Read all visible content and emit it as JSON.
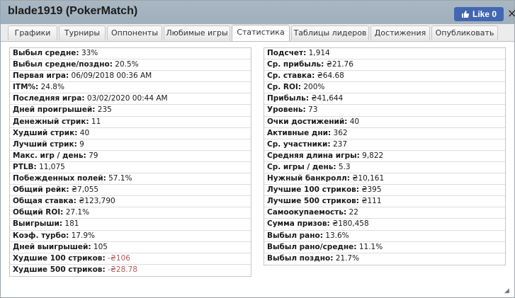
{
  "title": "blade1919 (PokerMatch)",
  "like_label": "Like 0",
  "tabs": [
    "Графики",
    "Турниры",
    "Оппоненты",
    "Любимые игры",
    "Статистика",
    "Таблицы лидеров",
    "Достижения",
    "Опубликовать"
  ],
  "active_tab": "Статистика",
  "left_stats": [
    {
      "label": "Выбыл средне:",
      "value": "33%"
    },
    {
      "label": "Выбыл средне/поздно:",
      "value": "20.5%"
    },
    {
      "label": "Первая игра:",
      "value": "06/09/2018 00:36 AM"
    },
    {
      "label": "ITM%:",
      "value": "24.8%"
    },
    {
      "label": "Последняя игра:",
      "value": "03/02/2020 00:44 AM"
    },
    {
      "label": "Дней проигрышей:",
      "value": "235"
    },
    {
      "label": "Денежный стрик:",
      "value": "11"
    },
    {
      "label": "Худший стрик:",
      "value": "40"
    },
    {
      "label": "Лучший стрик:",
      "value": "9"
    },
    {
      "label": "Макс. игр / день:",
      "value": "79"
    },
    {
      "label": "PTLB:",
      "value": "11,075"
    },
    {
      "label": "Побежденных полей:",
      "value": "57.1%"
    },
    {
      "label": "Общий рейк:",
      "value": "₴7,055"
    },
    {
      "label": "Общая ставка:",
      "value": "₴123,790"
    },
    {
      "label": "Общий ROI:",
      "value": "27.1%"
    },
    {
      "label": "Выигрыши:",
      "value": "181"
    },
    {
      "label": "Коэф. турбо:",
      "value": "17.9%"
    },
    {
      "label": "Дней выигрышей:",
      "value": "105"
    },
    {
      "label": "Худшие 100 стриков:",
      "value": "-₴106",
      "negative": true
    },
    {
      "label": "Худшие 500 стриков:",
      "value": "-₴28.78",
      "negative": true
    }
  ],
  "right_stats": [
    {
      "label": "Подсчет:",
      "value": "1,914"
    },
    {
      "label": "Ср. прибыль:",
      "value": "₴21.76"
    },
    {
      "label": "Ср. ставка:",
      "value": "₴64.68"
    },
    {
      "label": "Ср. ROI:",
      "value": "200%"
    },
    {
      "label": "Прибыль:",
      "value": "₴41,644"
    },
    {
      "label": "Уровень:",
      "value": "73"
    },
    {
      "label": "Очки достижений:",
      "value": "40"
    },
    {
      "label": "Активные дни:",
      "value": "362"
    },
    {
      "label": "Ср. участники:",
      "value": "237"
    },
    {
      "label": "Средняя длина игры:",
      "value": "9,822"
    },
    {
      "label": "Ср. игры / день:",
      "value": "5.3"
    },
    {
      "label": "Нужный банкролл:",
      "value": "₴10,161"
    },
    {
      "label": "Лучшие 100 стриков:",
      "value": "₴395"
    },
    {
      "label": "Лучшие 500 стриков:",
      "value": "₴111"
    },
    {
      "label": "Самоокупаемость:",
      "value": "22"
    },
    {
      "label": "Сумма призов:",
      "value": "₴180,458"
    },
    {
      "label": "Выбыл рано:",
      "value": "13.6%"
    },
    {
      "label": "Выбыл рано/средне:",
      "value": "11.1%"
    },
    {
      "label": "Выбыл поздно:",
      "value": "21.7%"
    }
  ],
  "colors": {
    "titlebar": "#a6b4bf",
    "like_button": "#4267b2",
    "negative": "#b05858"
  }
}
